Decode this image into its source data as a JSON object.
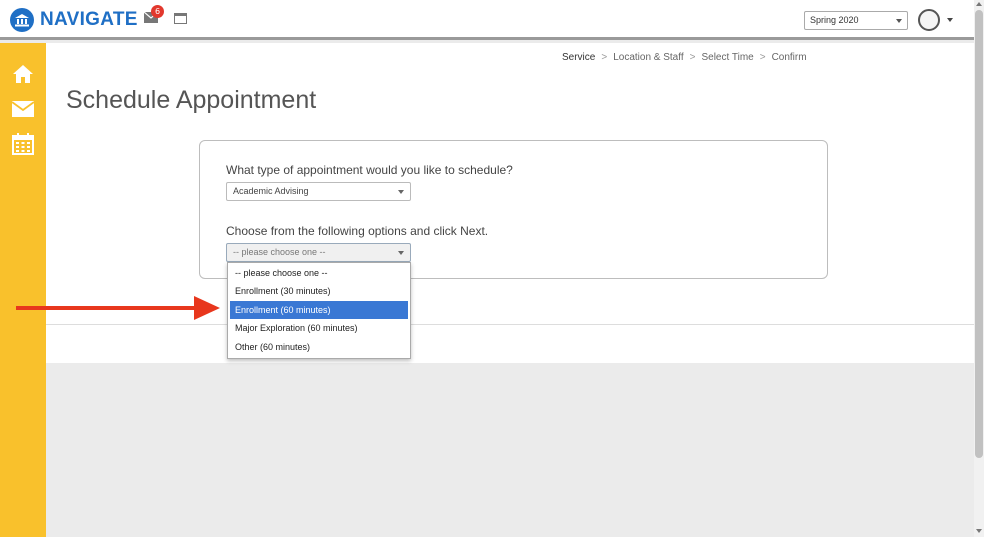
{
  "header": {
    "logo_text": "NAVIGATE",
    "mail_badge_count": "6",
    "term_select_value": "Spring 2020"
  },
  "breadcrumb": {
    "steps": [
      "Service",
      "Location & Staff",
      "Select Time",
      "Confirm"
    ],
    "separator": ">",
    "active_step": "Service"
  },
  "page": {
    "title": "Schedule Appointment"
  },
  "form": {
    "appointment_type_question": "What type of appointment would you like to schedule?",
    "appointment_type_value": "Academic Advising",
    "options_question": "Choose from the following options and click Next.",
    "options_value": "-- please choose one --",
    "dropdown_options": [
      "-- please choose one --",
      "Enrollment (30 minutes)",
      "Enrollment (60 minutes)",
      "Major Exploration (60 minutes)",
      "Other (60 minutes)"
    ],
    "highlighted_option": "Enrollment (60 minutes)"
  },
  "sidebar": {
    "items": [
      "home-icon",
      "mail-icon",
      "calendar-icon"
    ]
  },
  "colors": {
    "brand_blue": "#1f6fc5",
    "sidebar_yellow": "#f9c12c",
    "highlight_blue": "#3a78d4",
    "annotation_arrow_red": "#e8371d",
    "badge_red": "#e2382d"
  }
}
